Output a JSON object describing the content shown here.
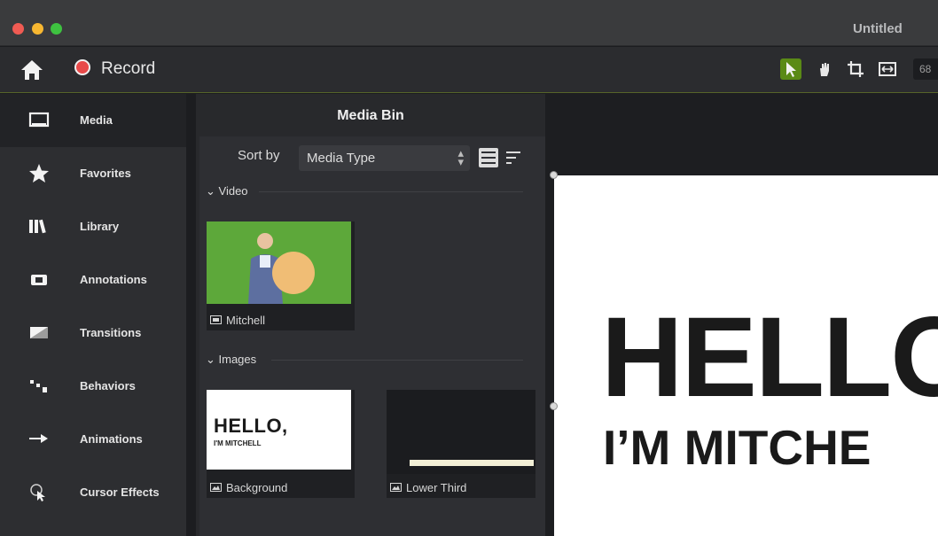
{
  "window": {
    "title": "Untitled"
  },
  "toolbar": {
    "record_label": "Record",
    "zoom_partial": "68"
  },
  "sidebar": {
    "items": [
      {
        "label": "Media",
        "icon": "media-icon",
        "active": true
      },
      {
        "label": "Favorites",
        "icon": "star-icon",
        "active": false
      },
      {
        "label": "Library",
        "icon": "library-icon",
        "active": false
      },
      {
        "label": "Annotations",
        "icon": "annotations-icon",
        "active": false
      },
      {
        "label": "Transitions",
        "icon": "transitions-icon",
        "active": false
      },
      {
        "label": "Behaviors",
        "icon": "behaviors-icon",
        "active": false
      },
      {
        "label": "Animations",
        "icon": "animations-icon",
        "active": false
      },
      {
        "label": "Cursor Effects",
        "icon": "cursor-effects-icon",
        "active": false
      }
    ]
  },
  "media_bin": {
    "title": "Media Bin",
    "sort_label": "Sort by",
    "sort_value": "Media Type",
    "sections": {
      "video": "Video",
      "images": "Images"
    },
    "video_items": [
      {
        "label": "Mitchell",
        "icon": "video-clip-icon"
      }
    ],
    "image_items": [
      {
        "label": "Background",
        "icon": "image-icon",
        "thumb_title": "HELLO,",
        "thumb_subtitle": "I'M MITCHELL"
      },
      {
        "label": "Lower Third",
        "icon": "image-icon"
      }
    ]
  },
  "canvas": {
    "headline": "HELLO",
    "subheadline": "I’M MITCHE"
  },
  "colors": {
    "accent_green": "#5a8a16",
    "record_red": "#e84a4a",
    "chroma_green": "#5da83a"
  }
}
